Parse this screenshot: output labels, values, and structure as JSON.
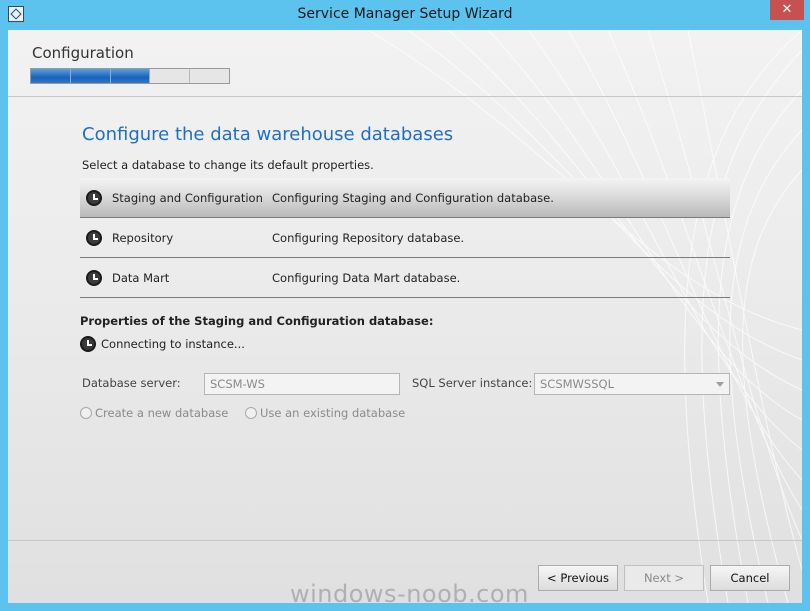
{
  "window": {
    "title": "Service Manager Setup Wizard",
    "close_glyph": "✕"
  },
  "header": {
    "stage": "Configuration",
    "progress": {
      "total_steps": 5,
      "completed_steps": 3
    }
  },
  "page": {
    "heading": "Configure the data warehouse databases",
    "description": "Select a database to change its default properties."
  },
  "databases": [
    {
      "name": "Staging and Configuration",
      "status": "Configuring Staging and Configuration database.",
      "selected": true,
      "icon": "clock-icon"
    },
    {
      "name": "Repository",
      "status": "Configuring Repository database.",
      "selected": false,
      "icon": "clock-icon"
    },
    {
      "name": "Data Mart",
      "status": "Configuring Data Mart database.",
      "selected": false,
      "icon": "clock-icon"
    }
  ],
  "properties": {
    "title": "Properties of the Staging and Configuration database:",
    "connecting_text": "Connecting to instance...",
    "db_server_label": "Database server:",
    "db_server_value": "SCSM-WS",
    "sql_instance_label": "SQL Server instance:",
    "sql_instance_value": "SCSMWSSQL",
    "create_new_label": "Create a new database",
    "use_existing_label": "Use an existing database"
  },
  "buttons": {
    "previous": "< Previous",
    "next": "Next >",
    "cancel": "Cancel"
  },
  "watermark": "windows-noob.com",
  "colors": {
    "titlebar": "#5bc3ee",
    "heading": "#1f6fc0",
    "progress_fill": "#1a62b8",
    "close_button": "#c75050"
  }
}
